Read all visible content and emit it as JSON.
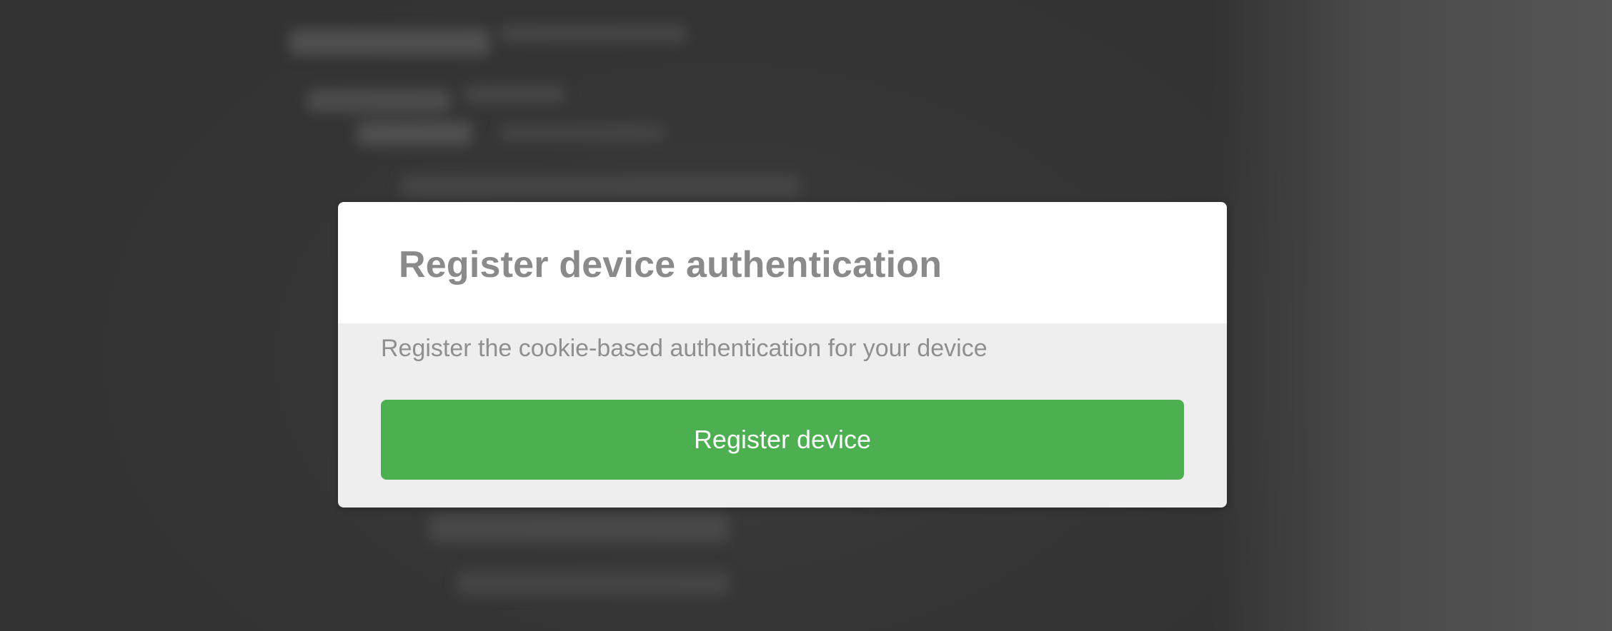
{
  "modal": {
    "title": "Register device authentication",
    "description": "Register the cookie-based authentication for your device",
    "register_button_label": "Register device"
  },
  "colors": {
    "backdrop": "#363636",
    "header_background": "#ffffff",
    "body_background": "#eeeeee",
    "title_text": "#8a8a8a",
    "description_text": "#8f8f8f",
    "button_background": "#4caf50",
    "button_text": "#ffffff"
  }
}
